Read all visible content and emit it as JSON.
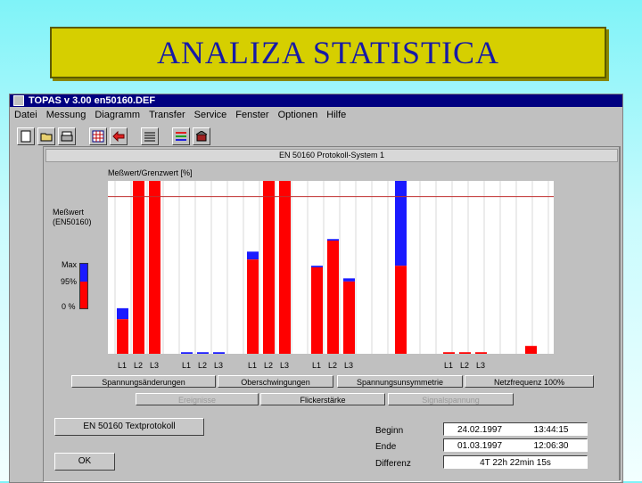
{
  "slide": {
    "title": "ANALIZA STATISTICA"
  },
  "window": {
    "title": "TOPAS  v 3.00  en50160.DEF"
  },
  "menu": [
    "Datei",
    "Messung",
    "Diagramm",
    "Transfer",
    "Service",
    "Fenster",
    "Optionen",
    "Hilfe"
  ],
  "toolbar_icons": [
    "new-file-icon",
    "open-folder-icon",
    "print-icon",
    "grid-icon",
    "back-arrow-icon",
    "text-list-icon",
    "color-list-icon",
    "building-icon"
  ],
  "panel": {
    "title": "EN 50160 Protokoll-System 1",
    "y_title": "Meßwert/Grenzwert [%]",
    "left_label": "Meßwert\n(EN50160)",
    "legend": {
      "max": "Max",
      "p95": "95%",
      "zero": "0 %"
    }
  },
  "colors": {
    "p95": "#ff0000",
    "max": "#1a1aff",
    "limit_line": "#c03030"
  },
  "chart_data": {
    "type": "bar",
    "ylabel": "Meßwert/Grenzwert [%]",
    "ylim": [
      0,
      110
    ],
    "limit_line": 100,
    "legend": [
      "Max",
      "95%",
      "0 %"
    ],
    "groups": [
      {
        "labels": [
          "L1",
          "L2",
          "L3"
        ],
        "p95": [
          22,
          110,
          110
        ],
        "max": [
          29,
          110,
          110
        ]
      },
      {
        "labels": [
          "L1",
          "L2",
          "L3"
        ],
        "p95": [
          0,
          0,
          0
        ],
        "max": [
          1,
          1,
          1
        ]
      },
      {
        "labels": [
          "L1",
          "L2",
          "L3"
        ],
        "p95": [
          60,
          110,
          110
        ],
        "max": [
          65,
          110,
          110
        ]
      },
      {
        "labels": [
          "L1",
          "L2",
          "L3"
        ],
        "p95": [
          55,
          72,
          46
        ],
        "max": [
          56,
          73,
          48
        ]
      },
      {
        "labels": [],
        "p95": [
          56
        ],
        "max": [
          110
        ]
      },
      {
        "labels": [
          "L1",
          "L2",
          "L3"
        ],
        "p95": [
          1,
          1,
          1
        ],
        "max": [
          1,
          1,
          1
        ]
      },
      {
        "labels": [],
        "p95": [
          5
        ],
        "max": [
          5
        ]
      }
    ]
  },
  "buttons": {
    "row1": [
      "Spannungsänderungen",
      "Oberschwingungen",
      "Spannungsunsymmetrie",
      "Netzfrequenz 100%"
    ],
    "row2": [
      "Ereignisse",
      "Flickerstärke",
      "Signalspannung"
    ],
    "textprotokoll": "EN 50160 Textprotokoll",
    "ok": "OK"
  },
  "times": {
    "begin_label": "Beginn",
    "begin_date": "24.02.1997",
    "begin_time": "13:44:15",
    "end_label": "Ende",
    "end_date": "01.03.1997",
    "end_time": "12:06:30",
    "diff_label": "Differenz",
    "diff_value": "4T 22h 22min 15s"
  }
}
